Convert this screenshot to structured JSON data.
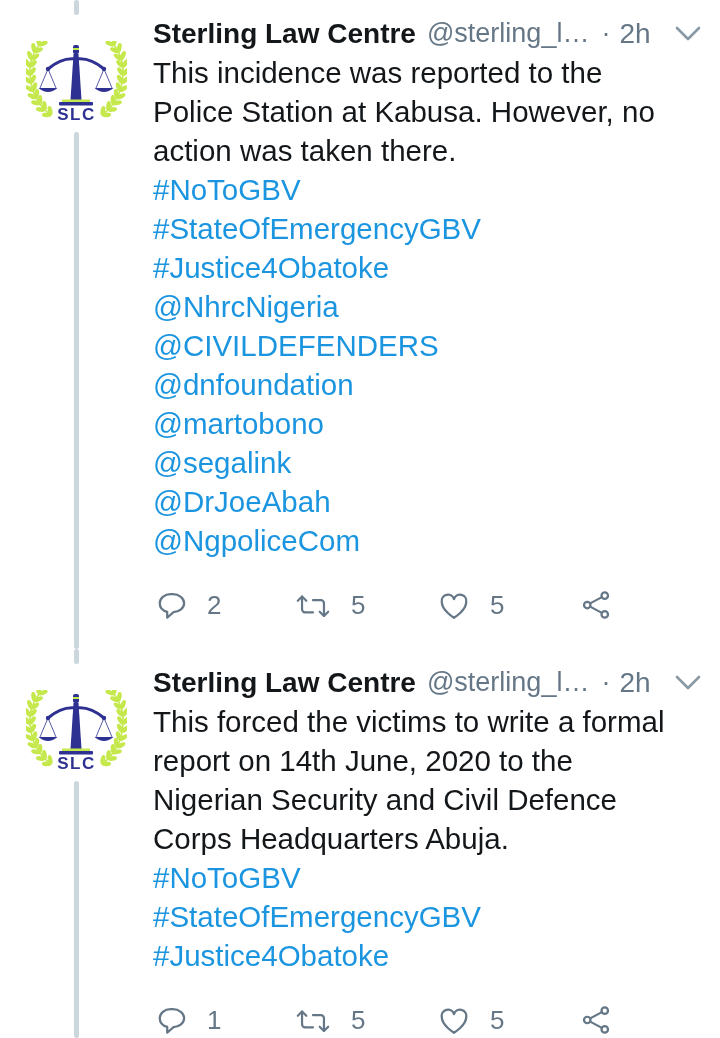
{
  "tweets": [
    {
      "connected_above": true,
      "connected_below": true,
      "avatar": {
        "logo_text": "SLC"
      },
      "author": {
        "name": "Sterling Law Centre",
        "handle": "@sterling_l…"
      },
      "separator": "·",
      "time": "2h",
      "body": "This incidence was reported to the Police Station at Kabusa. However, no action was taken there.",
      "links": [
        "#NoToGBV",
        "#StateOfEmergencyGBV",
        "#Justice4Obatoke",
        "@NhrcNigeria",
        "@CIVILDEFENDERS",
        "@dnfoundation",
        "@martobono",
        "@segalink",
        "@DrJoeAbah",
        "@NgpoliceCom"
      ],
      "actions": {
        "replies": "2",
        "retweets": "5",
        "likes": "5"
      }
    },
    {
      "connected_above": true,
      "connected_below": true,
      "avatar": {
        "logo_text": "SLC"
      },
      "author": {
        "name": "Sterling Law Centre",
        "handle": "@sterling_l…"
      },
      "separator": "·",
      "time": "2h",
      "body": "This forced the victims to write a formal report on 14th June, 2020 to the Nigerian Security and Civil Defence Corps Headquarters Abuja.",
      "links": [
        "#NoToGBV",
        "#StateOfEmergencyGBV",
        "#Justice4Obatoke"
      ],
      "actions": {
        "replies": "1",
        "retweets": "5",
        "likes": "5"
      }
    }
  ]
}
